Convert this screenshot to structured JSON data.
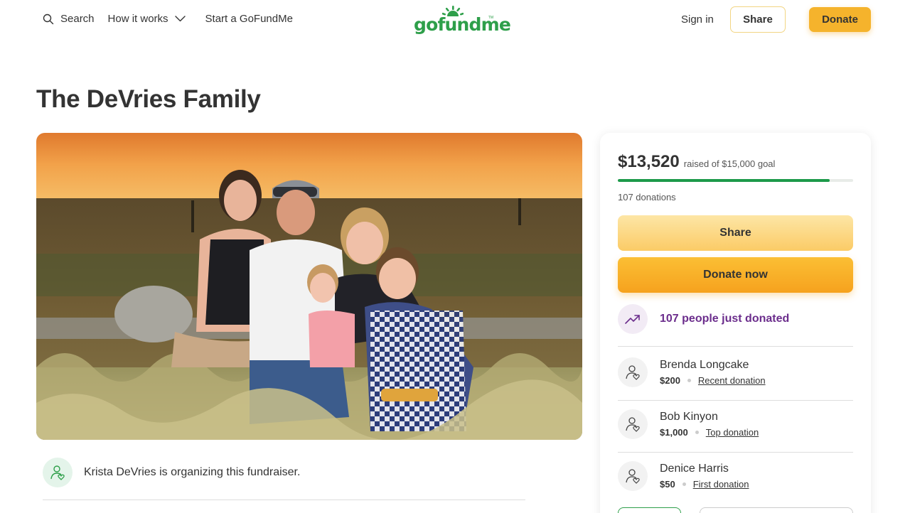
{
  "header": {
    "search_label": "Search",
    "how_it_works_label": "How it works",
    "start_label": "Start a GoFundMe",
    "logo_text": "gofundme",
    "logo_tm": "TM",
    "sign_in_label": "Sign in",
    "share_label": "Share",
    "donate_label": "Donate"
  },
  "campaign": {
    "title": "The DeVries Family",
    "organizer_text": "Krista DeVries is organizing this fundraiser."
  },
  "card": {
    "raised_amount": "$13,520",
    "goal_text": "raised of $15,000 goal",
    "progress_fraction": 0.9013,
    "donations_count": "107 donations",
    "share_label": "Share",
    "donate_now_label": "Donate now",
    "trend_text": "107 people just donated",
    "donors": [
      {
        "name": "Brenda Longcake",
        "amount": "$200",
        "tag": "Recent donation"
      },
      {
        "name": "Bob Kinyon",
        "amount": "$1,000",
        "tag": "Top donation"
      },
      {
        "name": "Denice Harris",
        "amount": "$50",
        "tag": "First donation"
      }
    ]
  },
  "colors": {
    "brand_green": "#2e9f4a",
    "donate_orange": "#f5b32c",
    "trend_purple": "#6b2d8c"
  },
  "icons": [
    "search-icon",
    "chevron-down-icon",
    "gofundme-sun-logo",
    "organizer-heart-icon",
    "trend-up-icon",
    "donor-heart-icon"
  ]
}
